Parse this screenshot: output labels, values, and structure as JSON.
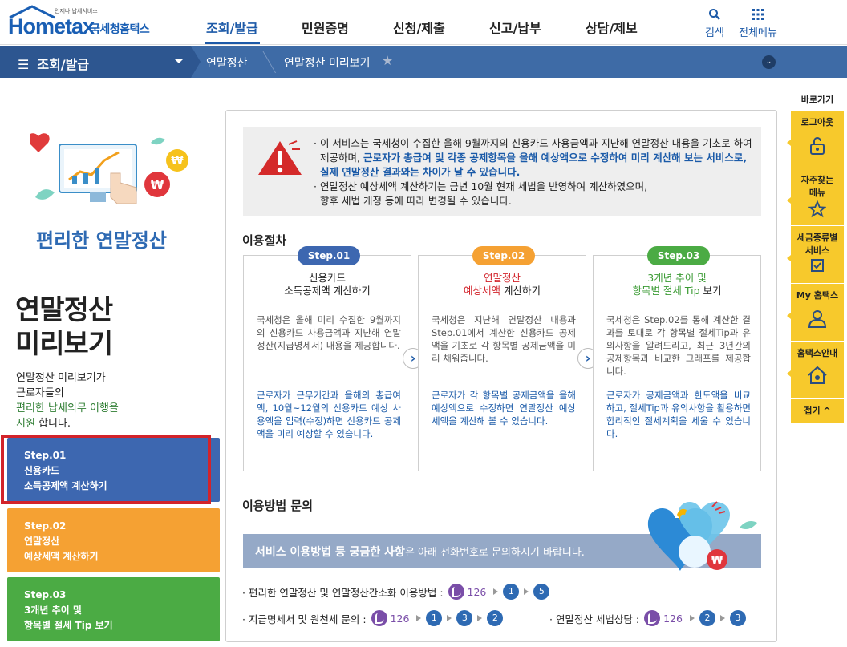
{
  "header": {
    "logo_small": "언제나 납세서비스",
    "logo_brand": "Hometax",
    "logo_org": "국세청홈택스",
    "gnb": [
      "조회/발급",
      "민원증명",
      "신청/제출",
      "신고/납부",
      "상담/제보"
    ],
    "search_label": "검색",
    "allmenu_label": "전체메뉴"
  },
  "subnav": {
    "selected": "조회/발급",
    "crumbs": [
      "연말정산",
      "연말정산 미리보기"
    ]
  },
  "side": {
    "subtitle": "편리한 연말정산",
    "title_line1": "연말정산",
    "title_line2": "미리보기",
    "desc1": "연말정산 미리보기가",
    "desc2": "근로자들의",
    "desc_green": "편리한 납세의무 이행을",
    "desc_green2": "지원",
    "desc3": " 합니다.",
    "steps": [
      {
        "l1": "Step.01",
        "l2": "신용카드",
        "l3": "소득공제액 계산하기"
      },
      {
        "l1": "Step.02",
        "l2": "연말정산",
        "l3": "예상세액 계산하기"
      },
      {
        "l1": "Step.03",
        "l2": "3개년 추이 및",
        "l3": "항목별 절세 Tip 보기"
      }
    ]
  },
  "notice": {
    "p1a": "· 이 서비스는 국세청이 수집한 올해 9월까지의 신용카드 사용금액과 지난해 연말정산 내용을 기초로 하여",
    "p1b": "제공하며, ",
    "p1c": "근로자가 총급여 및 각종 공제항목을 올해 예상액으로 수정하여 미리 계산해 보는 서비스로,",
    "p1d": "실제 연말정산 결과와는 차이가 날 수 있습니다.",
    "p2a": "· 연말정산 예상세액 계산하기는 금년 10월 현재 세법을 반영하여 계산하였으며,",
    "p2b": "향후 세법 개정 등에 따라 변경될 수 있습니다."
  },
  "procedure": {
    "heading": "이용절차",
    "cards": [
      {
        "badge": "Step.01",
        "t1": "신용카드",
        "t2": "소득공제액 계산하기",
        "body": "국세청은 올해 미리 수집한 9월까지의 신용카드 사용금액과 지난해 연말정산(지급명세서) 내용을 제공합니다.",
        "blue": "근로자가 근무기간과 올해의 총급여액, 10월~12월의 신용카드 예상 사용액을 입력(수정)하면 신용카드 공제액을 미리 예상할 수 있습니다."
      },
      {
        "badge": "Step.02",
        "t1": "연말정산",
        "t2a": "예상세액",
        "t2b": " 계산하기",
        "body": "국세청은 지난해 연말정산 내용과 Step.01에서 계산한 신용카드 공제액을 기초로 각 항목별 공제금액을 미리 채워줍니다.",
        "blue": "근로자가 각 항목별 공제금액을 올해예상액으로 수정하면 연말정산 예상세액을 계산해 볼 수 있습니다."
      },
      {
        "badge": "Step.03",
        "t1": "3개년 추이 및",
        "t2a": "항목별 절세 Tip",
        "t2b": " 보기",
        "body": "국세청은 Step.02를 통해 계산한 결과를 토대로 각 항목별 절세Tip과 유의사항을 알려드리고, 최근 3년간의 공제항목과 비교한 그래프를 제공합니다.",
        "blue": "근로자가 공제금액과 한도액을 비교하고, 절세Tip과 유의사항을 활용하면 합리적인 절세계획을 세울 수 있습니다."
      }
    ]
  },
  "inquiry": {
    "heading": "이용방법 문의",
    "banner_bold": "서비스 이용방법 등 궁금한 사항",
    "banner_rest": "은 아래 전화번호로 문의하시기 바랍니다.",
    "row1_label": "· 편리한 연말정산 및 연말정산간소화 이용방법 :",
    "row1_num": "126",
    "row1_seq": [
      "1",
      "5"
    ],
    "row2_label": "· 지급명세서 및 원천세 문의 :",
    "row2_num": "126",
    "row2_seq": [
      "1",
      "3",
      "2"
    ],
    "row3_label": "· 연말정산 세법상담 :",
    "row3_num": "126",
    "row3_seq": [
      "2",
      "3"
    ]
  },
  "quick": {
    "heading": "바로가기",
    "items": [
      {
        "label": "로그아웃"
      },
      {
        "label": "자주찾는",
        "label2": "메뉴"
      },
      {
        "label": "세금종류별",
        "label2": "서비스"
      },
      {
        "label": "My 홈택스"
      },
      {
        "label": "홈택스안내"
      }
    ],
    "fold": "접기 ^"
  }
}
